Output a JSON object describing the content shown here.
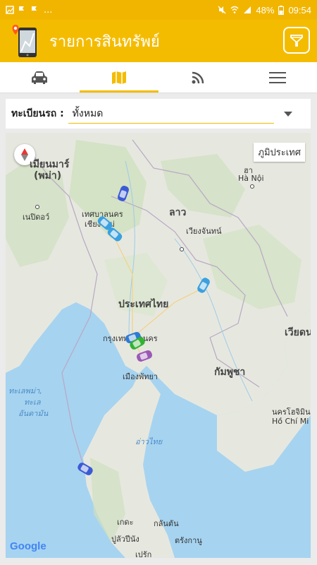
{
  "status_bar": {
    "battery": "48%",
    "time": "09:54",
    "overflow": "..."
  },
  "app_bar": {
    "title": "รายการสินทรัพย์",
    "logo_icon": "phone-map-pin-icon",
    "filter_icon": "filter-icon"
  },
  "tabs": [
    {
      "icon": "car-icon",
      "active": false
    },
    {
      "icon": "map-icon",
      "active": true
    },
    {
      "icon": "rss-icon",
      "active": false
    },
    {
      "icon": "menu-icon",
      "active": false
    }
  ],
  "filter": {
    "label": "ทะเบียนรถ :",
    "value": "ทั้งหมด"
  },
  "map": {
    "terrain_button": "ภูมิประเทศ",
    "google": "Google",
    "labels": {
      "myanmar": "เมียนมาร์",
      "myanmar_sub": "(พม่า)",
      "naypyidaw": "เนปิดอว์",
      "chiangmai_1": "เทศบาลนคร",
      "chiangmai_2": "เชียงใหม่",
      "laos": "ลาว",
      "hanoi_1": "ฮา",
      "hanoi_2": "Hà Nội",
      "vientiane": "เวียงจันทน์",
      "thailand": "ประเทศไทย",
      "bangkok": "กรุงเทพมหานคร",
      "vietnam": "เวียดน",
      "pattaya": "เมืองพัทยา",
      "cambodia": "กัมพูชา",
      "andaman_1": "ทะเลพม่า,",
      "andaman_2": "ทะเล",
      "andaman_3": "อันดามัน",
      "hcmc_1": "นครโฮจิมิน",
      "hcmc_2": "Hồ Chí Mi",
      "gulf": "อ่าวไทย",
      "kedah": "เกดะ",
      "kelantan": "กลันตัน",
      "penang": "ปูลัวปีนัง",
      "terengganu": "ตรังกานู",
      "perak": "เปรัก"
    }
  },
  "colors": {
    "brand": "#f4bc00",
    "status_bar": "#f1b500",
    "water": "#a6d3f0",
    "land": "#e6e8df"
  }
}
